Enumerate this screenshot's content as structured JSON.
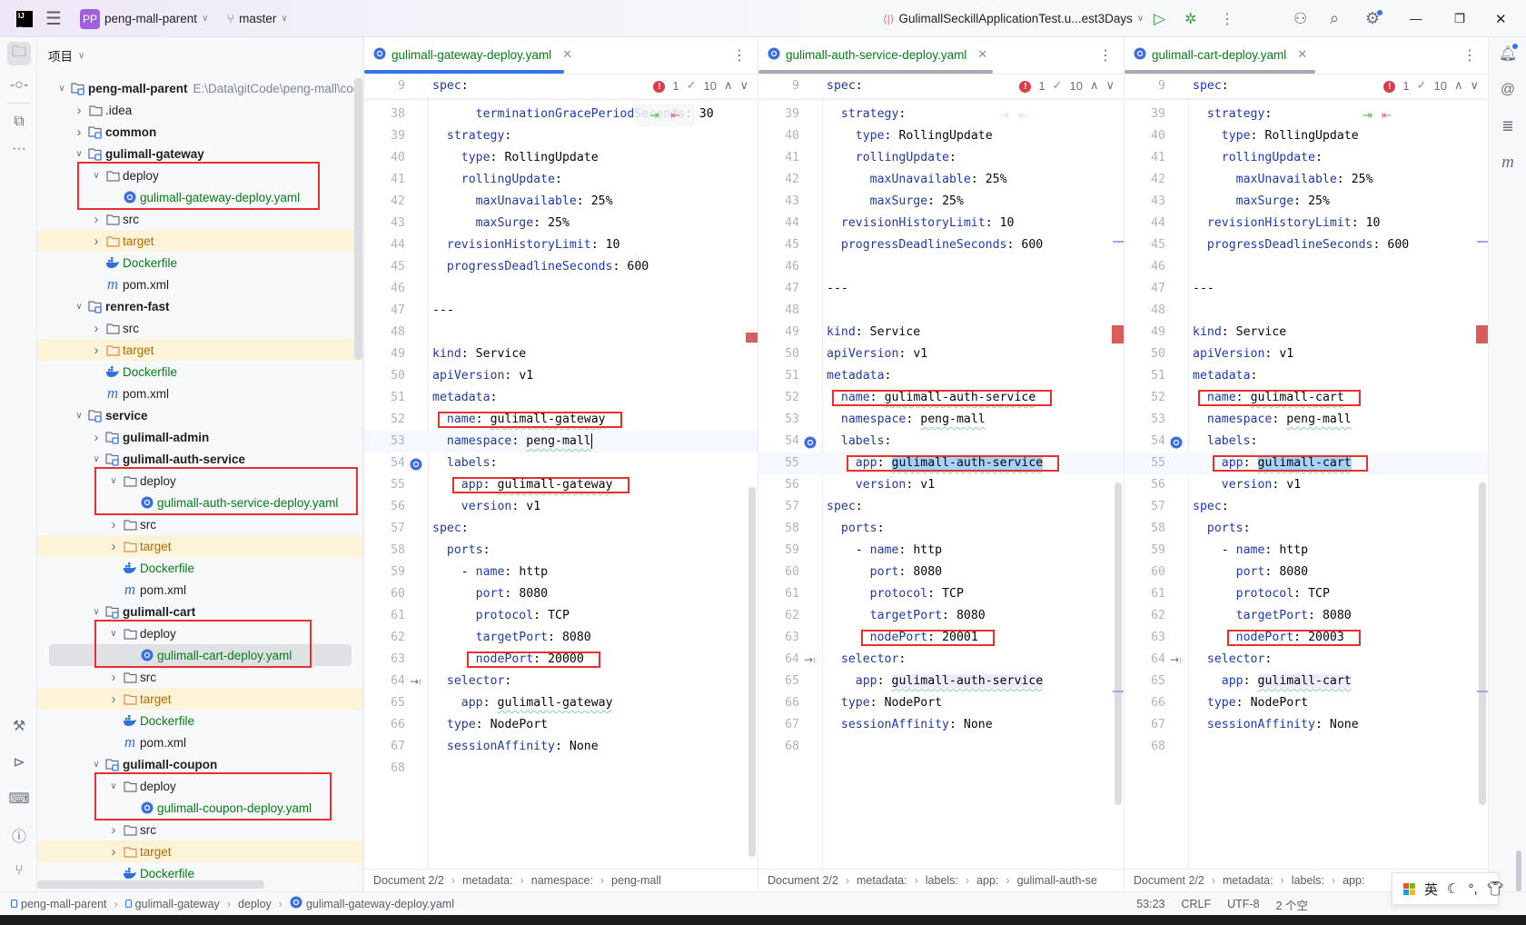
{
  "titlebar": {
    "project_badge": "PP",
    "project_name": "peng-mall-parent",
    "branch": "master",
    "run_config": "GulimallSeckillApplicationTest.u...est3Days",
    "accent": "#a35ee0"
  },
  "project_panel": {
    "title": "项目",
    "items": [
      {
        "label": "peng-mall-parent",
        "path": "E:\\Data\\gitCode\\peng-mall\\code",
        "level": 0,
        "kind": "module",
        "exp": true,
        "bold": true
      },
      {
        "label": ".idea",
        "level": 1,
        "kind": "folder",
        "exp": false
      },
      {
        "label": "common",
        "level": 1,
        "kind": "module",
        "exp": false,
        "bold": true
      },
      {
        "label": "gulimall-gateway",
        "level": 1,
        "kind": "module",
        "exp": true,
        "bold": true
      },
      {
        "label": "deploy",
        "level": 2,
        "kind": "folder",
        "exp": true,
        "box": "start"
      },
      {
        "label": "gulimall-gateway-deploy.yaml",
        "level": 3,
        "kind": "yaml",
        "box": "end"
      },
      {
        "label": "src",
        "level": 2,
        "kind": "folder",
        "exp": false
      },
      {
        "label": "target",
        "level": 2,
        "kind": "target",
        "exp": false
      },
      {
        "label": "Dockerfile",
        "level": 2,
        "kind": "docker"
      },
      {
        "label": "pom.xml",
        "level": 2,
        "kind": "pom"
      },
      {
        "label": "renren-fast",
        "level": 1,
        "kind": "module",
        "exp": true,
        "bold": true
      },
      {
        "label": "src",
        "level": 2,
        "kind": "folder",
        "exp": false
      },
      {
        "label": "target",
        "level": 2,
        "kind": "target",
        "exp": false
      },
      {
        "label": "Dockerfile",
        "level": 2,
        "kind": "docker"
      },
      {
        "label": "pom.xml",
        "level": 2,
        "kind": "pom"
      },
      {
        "label": "service",
        "level": 1,
        "kind": "module",
        "exp": true,
        "bold": true
      },
      {
        "label": "gulimall-admin",
        "level": 2,
        "kind": "module",
        "exp": false,
        "bold": true
      },
      {
        "label": "gulimall-auth-service",
        "level": 2,
        "kind": "module",
        "exp": true,
        "bold": true
      },
      {
        "label": "deploy",
        "level": 3,
        "kind": "folder",
        "exp": true,
        "box": "start"
      },
      {
        "label": "gulimall-auth-service-deploy.yaml",
        "level": 4,
        "kind": "yaml",
        "box": "end"
      },
      {
        "label": "src",
        "level": 3,
        "kind": "folder",
        "exp": false
      },
      {
        "label": "target",
        "level": 3,
        "kind": "target",
        "exp": false
      },
      {
        "label": "Dockerfile",
        "level": 3,
        "kind": "docker"
      },
      {
        "label": "pom.xml",
        "level": 3,
        "kind": "pom"
      },
      {
        "label": "gulimall-cart",
        "level": 2,
        "kind": "module",
        "exp": true,
        "bold": true
      },
      {
        "label": "deploy",
        "level": 3,
        "kind": "folder",
        "exp": true,
        "box": "start"
      },
      {
        "label": "gulimall-cart-deploy.yaml",
        "level": 4,
        "kind": "yaml",
        "box": "end",
        "selected": true
      },
      {
        "label": "src",
        "level": 3,
        "kind": "folder",
        "exp": false
      },
      {
        "label": "target",
        "level": 3,
        "kind": "target",
        "exp": false
      },
      {
        "label": "Dockerfile",
        "level": 3,
        "kind": "docker"
      },
      {
        "label": "pom.xml",
        "level": 3,
        "kind": "pom"
      },
      {
        "label": "gulimall-coupon",
        "level": 2,
        "kind": "module",
        "exp": true,
        "bold": true
      },
      {
        "label": "deploy",
        "level": 3,
        "kind": "folder",
        "exp": true,
        "box": "start"
      },
      {
        "label": "gulimall-coupon-deploy.yaml",
        "level": 4,
        "kind": "yaml",
        "box": "end"
      },
      {
        "label": "src",
        "level": 3,
        "kind": "folder",
        "exp": false
      },
      {
        "label": "target",
        "level": 3,
        "kind": "target",
        "exp": false
      },
      {
        "label": "Dockerfile",
        "level": 3,
        "kind": "docker"
      }
    ]
  },
  "colon": ":",
  "panes": [
    {
      "tab": "gulimall-gateway-deploy.yaml",
      "active": true,
      "sticky": {
        "n": "9",
        "k": "spec"
      },
      "errors": "1",
      "warnings": "10",
      "lines": [
        {
          "n": "38",
          "ind": "      ",
          "k": "terminationGracePeriodSeconds",
          "v": "30"
        },
        {
          "n": "39",
          "ind": "  ",
          "k": "strategy"
        },
        {
          "n": "40",
          "ind": "    ",
          "k": "type",
          "v": "RollingUpdate"
        },
        {
          "n": "41",
          "ind": "    ",
          "k": "rollingUpdate"
        },
        {
          "n": "42",
          "ind": "      ",
          "k": "maxUnavailable",
          "v": "25%"
        },
        {
          "n": "43",
          "ind": "      ",
          "k": "maxSurge",
          "v": "25%"
        },
        {
          "n": "44",
          "ind": "  ",
          "k": "revisionHistoryLimit",
          "v": "10"
        },
        {
          "n": "45",
          "ind": "  ",
          "k": "progressDeadlineSeconds",
          "v": "600"
        },
        {
          "n": "46"
        },
        {
          "n": "47",
          "plain": "---"
        },
        {
          "n": "48"
        },
        {
          "n": "49",
          "ind": "",
          "k": "kind",
          "v": "Service"
        },
        {
          "n": "50",
          "ind": "",
          "k": "apiVersion",
          "v": "v1"
        },
        {
          "n": "51",
          "ind": "",
          "k": "metadata"
        },
        {
          "n": "52",
          "ind": "  ",
          "k": "name",
          "v": "gulimall-gateway",
          "box": true,
          "sq": true
        },
        {
          "n": "53",
          "ind": "  ",
          "k": "namespace",
          "v": "peng-mall",
          "cur": true,
          "sq": true
        },
        {
          "n": "54",
          "ind": "  ",
          "k": "labels",
          "gutter": "k8s"
        },
        {
          "n": "55",
          "ind": "    ",
          "k": "app",
          "v": "gulimall-gateway",
          "box": true,
          "sq": true
        },
        {
          "n": "56",
          "ind": "    ",
          "k": "version",
          "v": "v1"
        },
        {
          "n": "57",
          "ind": "",
          "k": "spec"
        },
        {
          "n": "58",
          "ind": "  ",
          "k": "ports"
        },
        {
          "n": "59",
          "ind": "    ",
          "dash": "- ",
          "k": "name",
          "v": "http"
        },
        {
          "n": "60",
          "ind": "      ",
          "k": "port",
          "v": "8080"
        },
        {
          "n": "61",
          "ind": "      ",
          "k": "protocol",
          "v": "TCP"
        },
        {
          "n": "62",
          "ind": "      ",
          "k": "targetPort",
          "v": "8080"
        },
        {
          "n": "63",
          "ind": "      ",
          "k": "nodePort",
          "v": "20000",
          "box": true
        },
        {
          "n": "64",
          "ind": "  ",
          "k": "selector",
          "gutter": "link"
        },
        {
          "n": "65",
          "ind": "    ",
          "k": "app",
          "v": "gulimall-gateway",
          "sq": true
        },
        {
          "n": "66",
          "ind": "  ",
          "k": "type",
          "v": "NodePort"
        },
        {
          "n": "67",
          "ind": "  ",
          "k": "sessionAffinity",
          "v": "None"
        },
        {
          "n": "68"
        }
      ],
      "breadcrumb": [
        "Document 2/2",
        "metadata:",
        "namespace:",
        "peng-mall"
      ]
    },
    {
      "tab": "gulimall-auth-service-deploy.yaml",
      "active": false,
      "sticky": {
        "n": "9",
        "k": "spec"
      },
      "errors": "1",
      "warnings": "10",
      "lines": [
        {
          "n": "39",
          "ind": "  ",
          "k": "strategy"
        },
        {
          "n": "40",
          "ind": "    ",
          "k": "type",
          "v": "RollingUpdate"
        },
        {
          "n": "41",
          "ind": "    ",
          "k": "rollingUpdate"
        },
        {
          "n": "42",
          "ind": "      ",
          "k": "maxUnavailable",
          "v": "25%"
        },
        {
          "n": "43",
          "ind": "      ",
          "k": "maxSurge",
          "v": "25%"
        },
        {
          "n": "44",
          "ind": "  ",
          "k": "revisionHistoryLimit",
          "v": "10"
        },
        {
          "n": "45",
          "ind": "  ",
          "k": "progressDeadlineSeconds",
          "v": "600"
        },
        {
          "n": "46"
        },
        {
          "n": "47",
          "plain": "---"
        },
        {
          "n": "48"
        },
        {
          "n": "49",
          "ind": "",
          "k": "kind",
          "v": "Service"
        },
        {
          "n": "50",
          "ind": "",
          "k": "apiVersion",
          "v": "v1"
        },
        {
          "n": "51",
          "ind": "",
          "k": "metadata"
        },
        {
          "n": "52",
          "ind": "  ",
          "k": "name",
          "v": "gulimall-auth-service",
          "box": true,
          "sq": true
        },
        {
          "n": "53",
          "ind": "  ",
          "k": "namespace",
          "v": "peng-mall",
          "sq": true
        },
        {
          "n": "54",
          "ind": "  ",
          "k": "labels",
          "gutter": "k8s"
        },
        {
          "n": "55",
          "ind": "    ",
          "k": "app",
          "v": "gulimall-auth-service",
          "box": true,
          "cur": true,
          "hl": "sel",
          "sq": true
        },
        {
          "n": "56",
          "ind": "    ",
          "k": "version",
          "v": "v1"
        },
        {
          "n": "57",
          "ind": "",
          "k": "spec"
        },
        {
          "n": "58",
          "ind": "  ",
          "k": "ports"
        },
        {
          "n": "59",
          "ind": "    ",
          "dash": "- ",
          "k": "name",
          "v": "http"
        },
        {
          "n": "60",
          "ind": "      ",
          "k": "port",
          "v": "8080"
        },
        {
          "n": "61",
          "ind": "      ",
          "k": "protocol",
          "v": "TCP"
        },
        {
          "n": "62",
          "ind": "      ",
          "k": "targetPort",
          "v": "8080"
        },
        {
          "n": "63",
          "ind": "      ",
          "k": "nodePort",
          "v": "20001",
          "box": true
        },
        {
          "n": "64",
          "ind": "  ",
          "k": "selector",
          "gutter": "link"
        },
        {
          "n": "65",
          "ind": "    ",
          "k": "app",
          "v": "gulimall-auth-service",
          "hl": "usage",
          "sq": true
        },
        {
          "n": "66",
          "ind": "  ",
          "k": "type",
          "v": "NodePort"
        },
        {
          "n": "67",
          "ind": "  ",
          "k": "sessionAffinity",
          "v": "None"
        },
        {
          "n": "68"
        }
      ],
      "breadcrumb": [
        "Document 2/2",
        "metadata:",
        "labels:",
        "app:",
        "gulimall-auth-se"
      ]
    },
    {
      "tab": "gulimall-cart-deploy.yaml",
      "active": false,
      "sticky": {
        "n": "9",
        "k": "spec"
      },
      "errors": "1",
      "warnings": "10",
      "lines": [
        {
          "n": "39",
          "ind": "  ",
          "k": "strategy"
        },
        {
          "n": "40",
          "ind": "    ",
          "k": "type",
          "v": "RollingUpdate"
        },
        {
          "n": "41",
          "ind": "    ",
          "k": "rollingUpdate"
        },
        {
          "n": "42",
          "ind": "      ",
          "k": "maxUnavailable",
          "v": "25%"
        },
        {
          "n": "43",
          "ind": "      ",
          "k": "maxSurge",
          "v": "25%"
        },
        {
          "n": "44",
          "ind": "  ",
          "k": "revisionHistoryLimit",
          "v": "10"
        },
        {
          "n": "45",
          "ind": "  ",
          "k": "progressDeadlineSeconds",
          "v": "600"
        },
        {
          "n": "46"
        },
        {
          "n": "47",
          "plain": "---"
        },
        {
          "n": "48"
        },
        {
          "n": "49",
          "ind": "",
          "k": "kind",
          "v": "Service"
        },
        {
          "n": "50",
          "ind": "",
          "k": "apiVersion",
          "v": "v1"
        },
        {
          "n": "51",
          "ind": "",
          "k": "metadata"
        },
        {
          "n": "52",
          "ind": "  ",
          "k": "name",
          "v": "gulimall-cart",
          "box": true,
          "sq": true
        },
        {
          "n": "53",
          "ind": "  ",
          "k": "namespace",
          "v": "peng-mall",
          "sq": true
        },
        {
          "n": "54",
          "ind": "  ",
          "k": "labels",
          "gutter": "k8s"
        },
        {
          "n": "55",
          "ind": "    ",
          "k": "app",
          "v": "gulimall-cart",
          "box": true,
          "cur": true,
          "hl": "sel",
          "sq": true
        },
        {
          "n": "56",
          "ind": "    ",
          "k": "version",
          "v": "v1"
        },
        {
          "n": "57",
          "ind": "",
          "k": "spec"
        },
        {
          "n": "58",
          "ind": "  ",
          "k": "ports"
        },
        {
          "n": "59",
          "ind": "    ",
          "dash": "- ",
          "k": "name",
          "v": "http"
        },
        {
          "n": "60",
          "ind": "      ",
          "k": "port",
          "v": "8080"
        },
        {
          "n": "61",
          "ind": "      ",
          "k": "protocol",
          "v": "TCP"
        },
        {
          "n": "62",
          "ind": "      ",
          "k": "targetPort",
          "v": "8080"
        },
        {
          "n": "63",
          "ind": "      ",
          "k": "nodePort",
          "v": "20003",
          "box": true
        },
        {
          "n": "64",
          "ind": "  ",
          "k": "selector",
          "gutter": "link"
        },
        {
          "n": "65",
          "ind": "    ",
          "k": "app",
          "v": "gulimall-cart",
          "hl": "usage",
          "sq": true
        },
        {
          "n": "66",
          "ind": "  ",
          "k": "type",
          "v": "NodePort"
        },
        {
          "n": "67",
          "ind": "  ",
          "k": "sessionAffinity",
          "v": "None"
        },
        {
          "n": "68"
        }
      ],
      "breadcrumb": [
        "Document 2/2",
        "metadata:",
        "labels:",
        "app:"
      ]
    }
  ],
  "statusbar": {
    "path": [
      "peng-mall-parent",
      "gulimall-gateway",
      "deploy",
      "gulimall-gateway-deploy.yaml"
    ],
    "position": "53:23",
    "line_ending": "CRLF",
    "encoding": "UTF-8",
    "indent": "2 个空"
  },
  "ime": {
    "mode": "英"
  }
}
